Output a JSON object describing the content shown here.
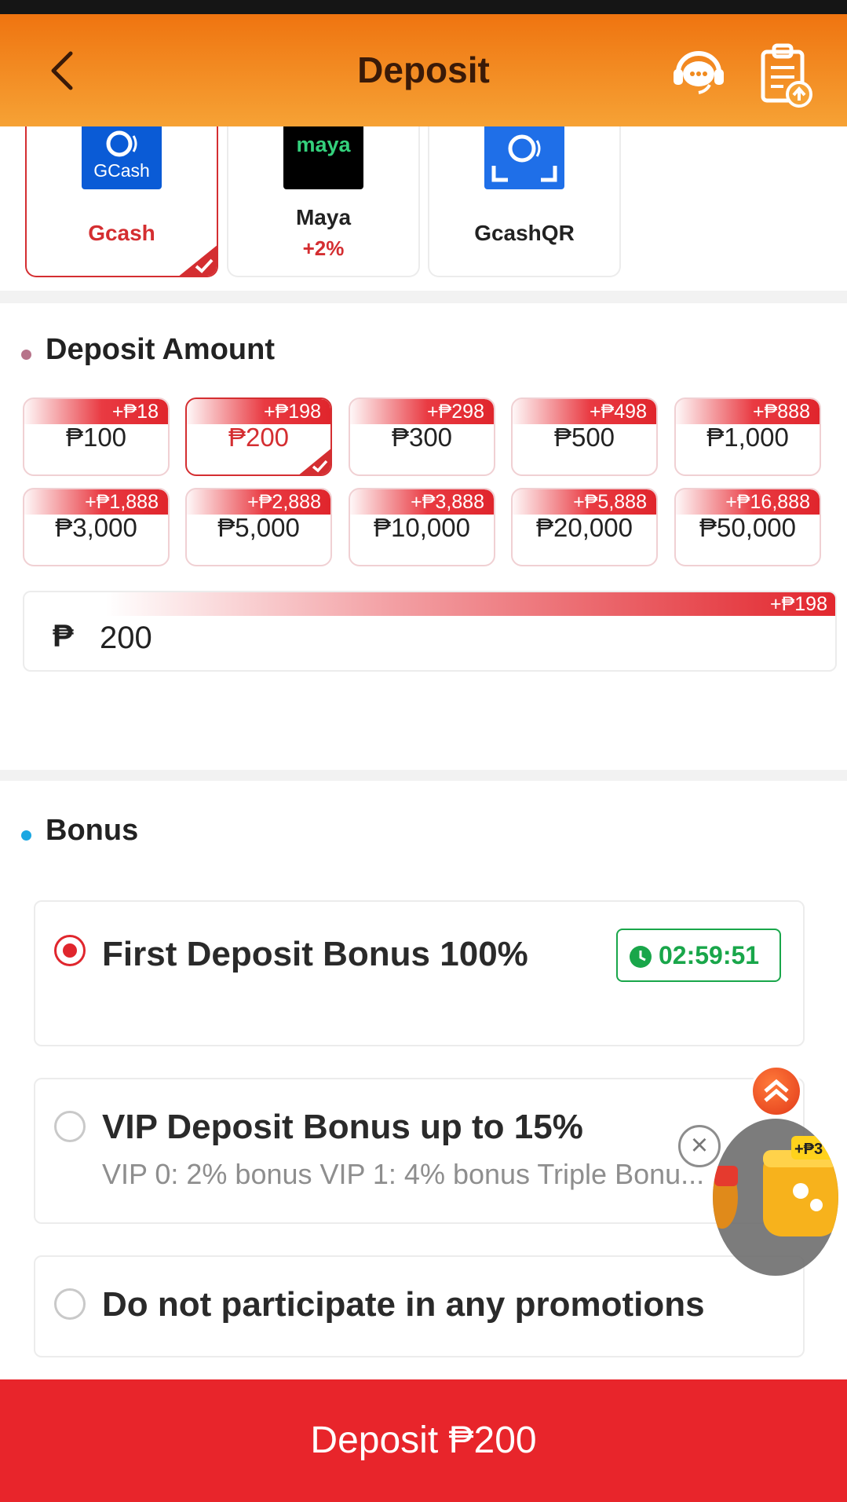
{
  "header": {
    "title": "Deposit"
  },
  "methods": [
    {
      "name": "Gcash",
      "logo_text": "GCash",
      "bonus": ""
    },
    {
      "name": "Maya",
      "logo_text": "maya",
      "bonus": "+2%"
    },
    {
      "name": "GcashQR",
      "logo_text": "G",
      "bonus": ""
    }
  ],
  "deposit_amount": {
    "title": "Deposit Amount",
    "options": [
      {
        "amount": "₱100",
        "bonus": "+₱18"
      },
      {
        "amount": "₱200",
        "bonus": "+₱198"
      },
      {
        "amount": "₱300",
        "bonus": "+₱298"
      },
      {
        "amount": "₱500",
        "bonus": "+₱498"
      },
      {
        "amount": "₱1,000",
        "bonus": "+₱888"
      },
      {
        "amount": "₱3,000",
        "bonus": "+₱1,888"
      },
      {
        "amount": "₱5,000",
        "bonus": "+₱2,888"
      },
      {
        "amount": "₱10,000",
        "bonus": "+₱3,888"
      },
      {
        "amount": "₱20,000",
        "bonus": "+₱5,888"
      },
      {
        "amount": "₱50,000",
        "bonus": "+₱16,888"
      }
    ],
    "currency_symbol": "₱",
    "input_value": "200",
    "input_bonus": "+₱198"
  },
  "bonus": {
    "title": "Bonus",
    "items": [
      {
        "title": "First Deposit Bonus 100%",
        "timer": "02:59:51"
      },
      {
        "title": "VIP Deposit Bonus up to 15%",
        "description": "VIP 0: 2% bonus VIP 1: 4% bonus Triple Bonu..."
      },
      {
        "title": "Do not participate in any promotions"
      }
    ]
  },
  "floating": {
    "badge": "+₱3"
  },
  "footer": {
    "deposit_label": "Deposit ₱200"
  },
  "colors": {
    "accent": "#e8252b",
    "header": "#ef7410",
    "timer": "#19a64a"
  }
}
